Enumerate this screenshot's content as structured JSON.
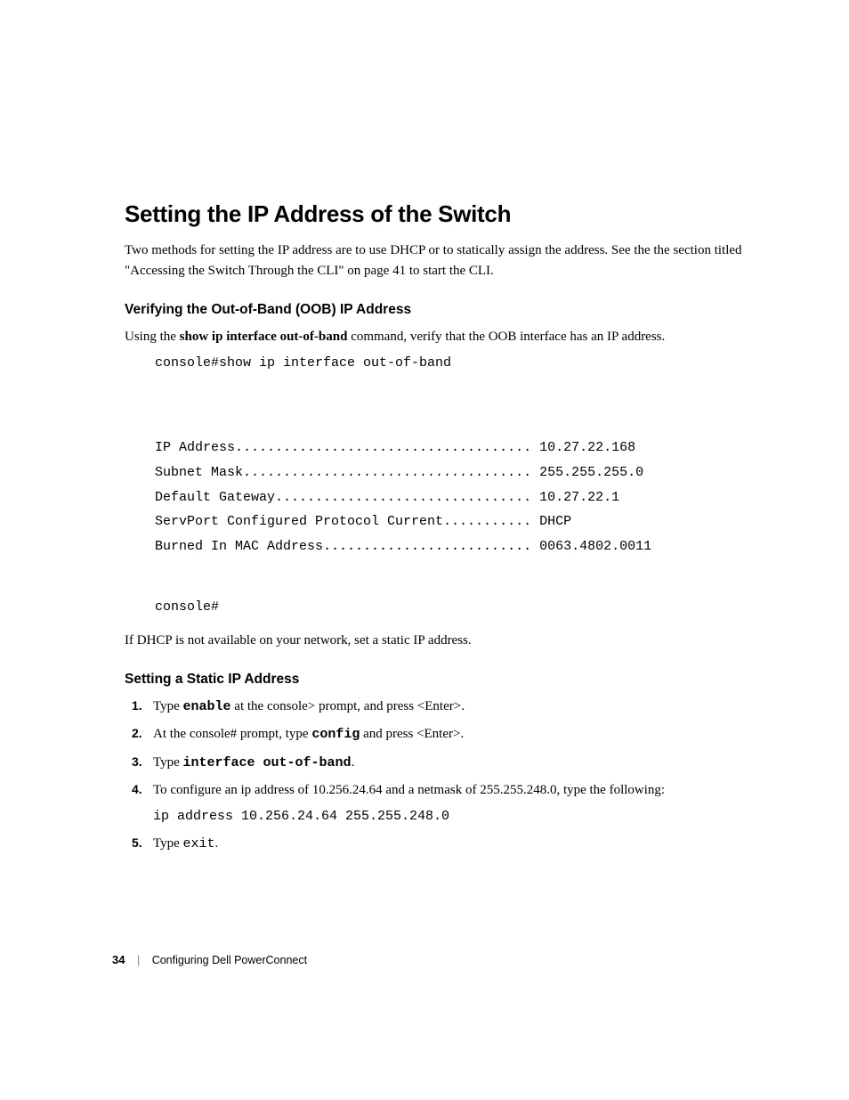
{
  "heading": "Setting the IP Address of the Switch",
  "intro": "Two methods for setting the IP address are to use DHCP or to statically assign the address. See the the section titled \"Accessing the Switch Through the CLI\" on page 41 to start the CLI.",
  "section1": {
    "heading": "Verifying the Out-of-Band (OOB) IP Address",
    "lead_pre": "Using the ",
    "lead_bold": "show ip interface out-of-band",
    "lead_post": " command, verify that the OOB interface has an IP address.",
    "console_cmd": "console#show ip interface out-of-band",
    "output": {
      "l1": "IP Address..................................... 10.27.22.168",
      "l2": "Subnet Mask.................................... 255.255.255.0",
      "l3": "Default Gateway................................ 10.27.22.1",
      "l4": "ServPort Configured Protocol Current........... DHCP",
      "l5": "Burned In MAC Address.......................... 0063.4802.0011"
    },
    "prompt_after": "console#",
    "dhcp_note": "If DHCP is not available on your network, set a static IP address."
  },
  "section2": {
    "heading": "Setting a Static IP Address",
    "steps": {
      "s1_a": "Type ",
      "s1_b": "enable",
      "s1_c": " at the console> prompt, and press <Enter>.",
      "s2_a": "At the console# prompt, type ",
      "s2_b": "config",
      "s2_c": " and press <Enter>.",
      "s3_a": "Type ",
      "s3_b": "interface out-of-band",
      "s3_c": ".",
      "s4_a": "To configure an ip address of 10.256.24.64 and a netmask of 255.255.248.0, type the following:",
      "s4_code": "ip address 10.256.24.64 255.255.248.0",
      "s5_a": "Type ",
      "s5_code": "exit",
      "s5_c": "."
    }
  },
  "footer": {
    "page_num": "34",
    "chapter": "Configuring Dell PowerConnect"
  }
}
